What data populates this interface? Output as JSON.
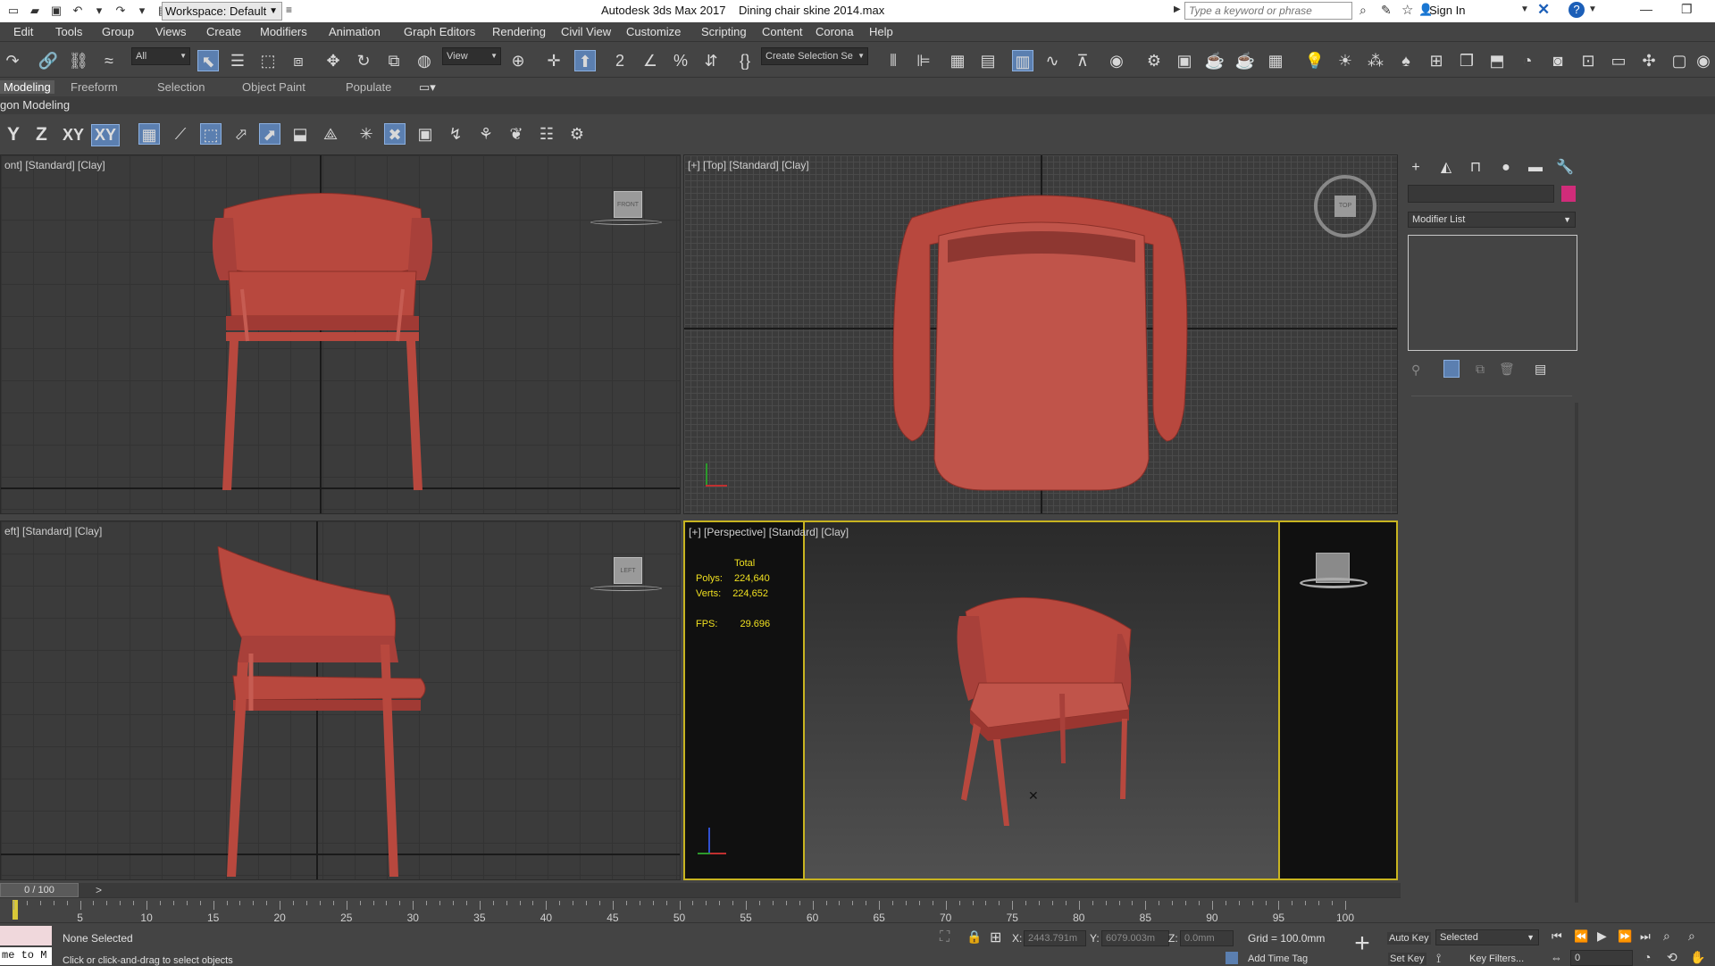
{
  "title_bar": {
    "workspace": "Workspace: Default",
    "app_title": "Autodesk 3ds Max 2017",
    "file_name": "Dining chair skine 2014.max",
    "search_placeholder": "Type a keyword or phrase",
    "sign_in": "Sign In"
  },
  "menu": [
    "Edit",
    "Tools",
    "Group",
    "Views",
    "Create",
    "Modifiers",
    "Animation",
    "Graph Editors",
    "Rendering",
    "Civil View",
    "Customize",
    "Scripting",
    "Content",
    "Corona",
    "Help"
  ],
  "main_toolbar": {
    "selection_filter": "All",
    "ref_coord": "View",
    "selection_set": "Create Selection Se"
  },
  "ribbon": {
    "tabs": [
      "Modeling",
      "Freeform",
      "Selection",
      "Object Paint",
      "Populate"
    ],
    "active_tab": "Modeling",
    "panel_label": "gon Modeling"
  },
  "axis_buttons": [
    "Y",
    "Z",
    "XY",
    "XY"
  ],
  "viewports": {
    "front": {
      "label": "ont] [Standard] [Clay]",
      "cube": "FRONT"
    },
    "top": {
      "label": "[+] [Top] [Standard] [Clay]",
      "cube": "TOP"
    },
    "left": {
      "label": "eft] [Standard] [Clay]",
      "cube": "LEFT"
    },
    "perspective": {
      "label": "[+] [Perspective] [Standard] [Clay]",
      "stats": {
        "header": "Total",
        "polys_label": "Polys:",
        "polys": "224,640",
        "verts_label": "Verts:",
        "verts": "224,652",
        "fps_label": "FPS:",
        "fps": "29.696"
      }
    }
  },
  "command_panel": {
    "modifier_list": "Modifier List"
  },
  "timeline": {
    "frame": "0 / 100",
    "ticks": [
      "5",
      "10",
      "15",
      "20",
      "25",
      "30",
      "35",
      "40",
      "45",
      "50",
      "55",
      "60",
      "65",
      "70",
      "75",
      "80",
      "85",
      "90",
      "95",
      "100"
    ]
  },
  "status": {
    "selection": "None Selected",
    "prompt": "Click or click-and-drag to select objects",
    "maxscript": "me to M",
    "x_label": "X:",
    "x_value": "2443.791m",
    "y_label": "Y:",
    "y_value": "6079.003m",
    "z_label": "Z:",
    "z_value": "0.0mm",
    "grid": "Grid = 100.0mm",
    "add_time_tag": "Add Time Tag",
    "auto_key": "Auto Key",
    "set_key": "Set Key",
    "key_mode": "Selected",
    "key_filters": "Key Filters...",
    "current_frame": "0"
  },
  "colors": {
    "chair": "#b8483e",
    "active_viewport_border": "#c8b420",
    "stats_text": "#f0e020",
    "object_color": "#d02c7a"
  }
}
